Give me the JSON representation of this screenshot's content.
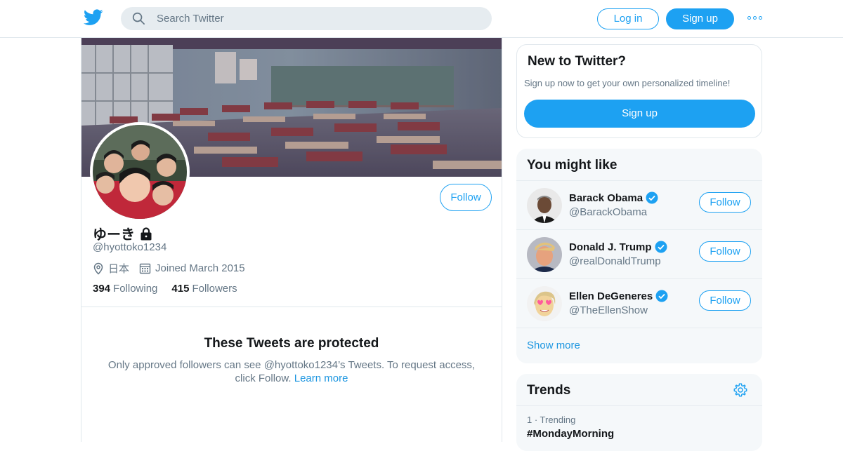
{
  "header": {
    "search_placeholder": "Search Twitter",
    "login_label": "Log in",
    "signup_label": "Sign up",
    "brand_color": "#1da1f2"
  },
  "profile": {
    "display_name": "ゆーき",
    "handle": "@hyottoko1234",
    "location": "日本",
    "joined": "Joined March 2015",
    "following_count": "394",
    "following_label": "Following",
    "followers_count": "415",
    "followers_label": "Followers",
    "follow_label": "Follow",
    "protected_title": "These Tweets are protected",
    "protected_text": "Only approved followers can see @hyottoko1234’s Tweets. To request access, click Follow.",
    "learn_more": "Learn more"
  },
  "new_to_twitter": {
    "title": "New to Twitter?",
    "subtitle": "Sign up now to get your own personalized timeline!",
    "button": "Sign up"
  },
  "you_might_like": {
    "title": "You might like",
    "accounts": [
      {
        "name": "Barack Obama",
        "handle": "@BarackObama",
        "follow": "Follow"
      },
      {
        "name": "Donald J. Trump",
        "handle": "@realDonaldTrump",
        "follow": "Follow"
      },
      {
        "name": "Ellen DeGeneres",
        "handle": "@TheEllenShow",
        "follow": "Follow"
      }
    ],
    "show_more": "Show more"
  },
  "trends": {
    "title": "Trends",
    "items": [
      {
        "rank": "1 · Trending",
        "topic": "#MondayMorning"
      }
    ]
  }
}
